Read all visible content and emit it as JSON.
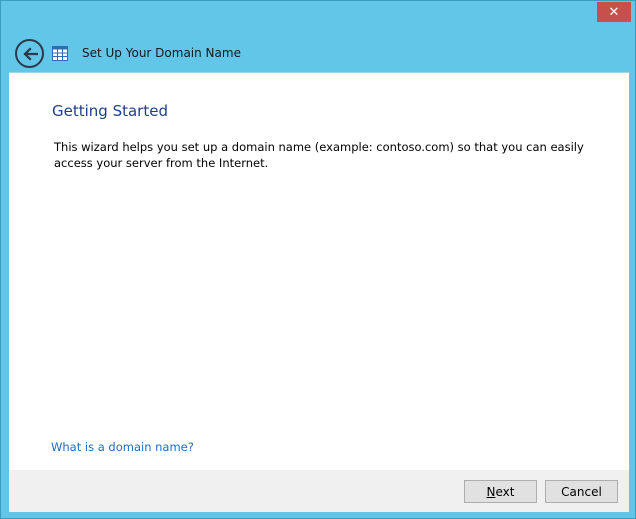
{
  "window": {
    "title": "Set Up Your Domain Name",
    "close_label": "✕"
  },
  "main": {
    "heading": "Getting Started",
    "description": "This wizard helps you set up a domain name (example: contoso.com) so that you can easily access your server from the Internet.",
    "help_link": "What is a domain name?"
  },
  "footer": {
    "next_access_key": "N",
    "next_rest": "ext",
    "cancel_label": "Cancel"
  }
}
